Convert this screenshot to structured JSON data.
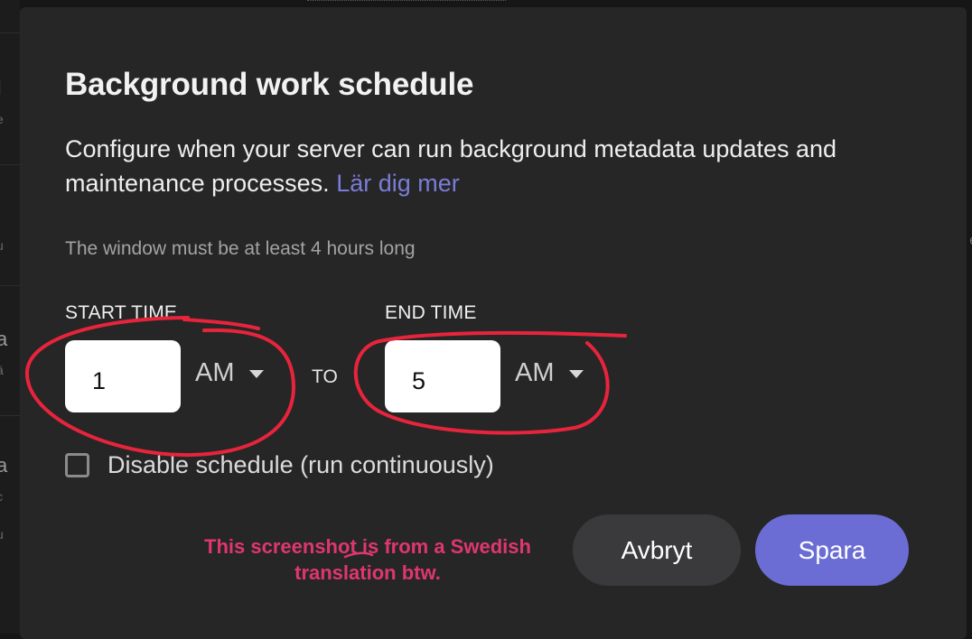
{
  "modal": {
    "title": "Background work schedule",
    "description": "Configure when your server can run background metadata updates and maintenance processes.",
    "learn_more": "Lär dig mer",
    "hint": "The window must be at least 4 hours long"
  },
  "schedule": {
    "start_label": "START TIME",
    "start_value": "1",
    "start_period": "AM",
    "to_label": "TO",
    "end_label": "END TIME",
    "end_value": "5",
    "end_period": "AM",
    "disable_label": "Disable schedule (run continuously)",
    "disable_checked": false
  },
  "buttons": {
    "cancel": "Avbryt",
    "save": "Spara"
  },
  "annotation": {
    "note_line1": "This screenshot is from a Swedish",
    "note_line2": "translation btw.",
    "color": "#e0366f",
    "stroke_color": "#e8243c"
  },
  "colors": {
    "modal_bg": "#262626",
    "accent": "#6b6dd4",
    "link": "#7a7cd8"
  }
}
